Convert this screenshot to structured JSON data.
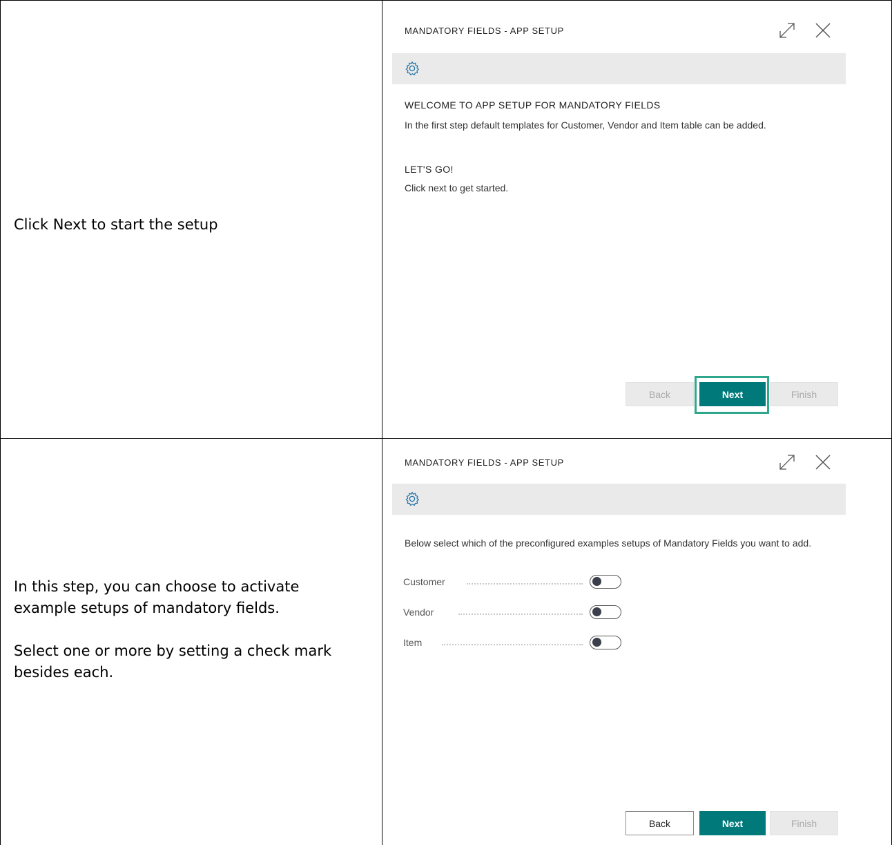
{
  "rows": [
    {
      "instruction": {
        "paragraphs": [
          "Click Next to start the setup"
        ]
      },
      "panel": {
        "title": "MANDATORY FIELDS - APP SETUP",
        "welcome_heading": "WELCOME TO APP SETUP FOR MANDATORY FIELDS",
        "welcome_text": "In the first step default templates for Customer, Vendor and Item table can be added.",
        "go_heading": "LET'S GO!",
        "go_text": "Click next to get started.",
        "buttons": {
          "back": "Back",
          "next": "Next",
          "finish": "Finish"
        },
        "back_enabled": false,
        "next_highlighted": true
      }
    },
    {
      "instruction": {
        "paragraphs": [
          "In this step, you can choose to activate example setups of mandatory fields.",
          "Select one or more by setting a check mark besides each."
        ]
      },
      "panel": {
        "title": "MANDATORY FIELDS - APP SETUP",
        "intro_text": "Below select which of the preconfigured examples setups of Mandatory Fields you want to add.",
        "fields": [
          {
            "label": "Customer",
            "enabled": false
          },
          {
            "label": "Vendor",
            "enabled": false
          },
          {
            "label": "Item",
            "enabled": false
          }
        ],
        "buttons": {
          "back": "Back",
          "next": "Next",
          "finish": "Finish"
        },
        "back_enabled": true
      }
    }
  ],
  "icons": {
    "gear": "gear-icon",
    "expand": "expand-icon",
    "close": "close-icon",
    "accent_color": "#00797b",
    "highlight_color": "#2fa78b"
  }
}
